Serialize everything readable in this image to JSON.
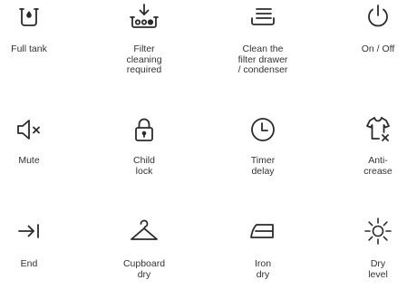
{
  "symbols": {
    "full_tank": {
      "icon": "full-tank-icon",
      "label": "Full tank"
    },
    "filter_cleaning": {
      "icon": "filter-cleaning-icon",
      "label": "Filter\ncleaning\nrequired"
    },
    "clean_filter_drawer": {
      "icon": "filter-drawer-icon",
      "label": "Clean the\nfilter drawer\n/ condenser"
    },
    "on_off": {
      "icon": "power-icon",
      "label": "On / Off"
    },
    "mute": {
      "icon": "mute-icon",
      "label": "Mute"
    },
    "child_lock": {
      "icon": "lock-icon",
      "label": "Child\nlock"
    },
    "timer_delay": {
      "icon": "clock-icon",
      "label": "Timer\ndelay"
    },
    "anti_crease": {
      "icon": "anti-crease-icon",
      "label": "Anti-\ncrease"
    },
    "end": {
      "icon": "end-arrow-icon",
      "label": "End"
    },
    "cupboard_dry": {
      "icon": "hanger-icon",
      "label": "Cupboard\ndry"
    },
    "iron_dry": {
      "icon": "iron-icon",
      "label": "Iron\ndry"
    },
    "dry_level": {
      "icon": "sun-icon",
      "label": "Dry\nlevel"
    }
  },
  "colors": {
    "icon_stroke": "#2b2b2b",
    "text": "#333333",
    "background": "#ffffff"
  }
}
